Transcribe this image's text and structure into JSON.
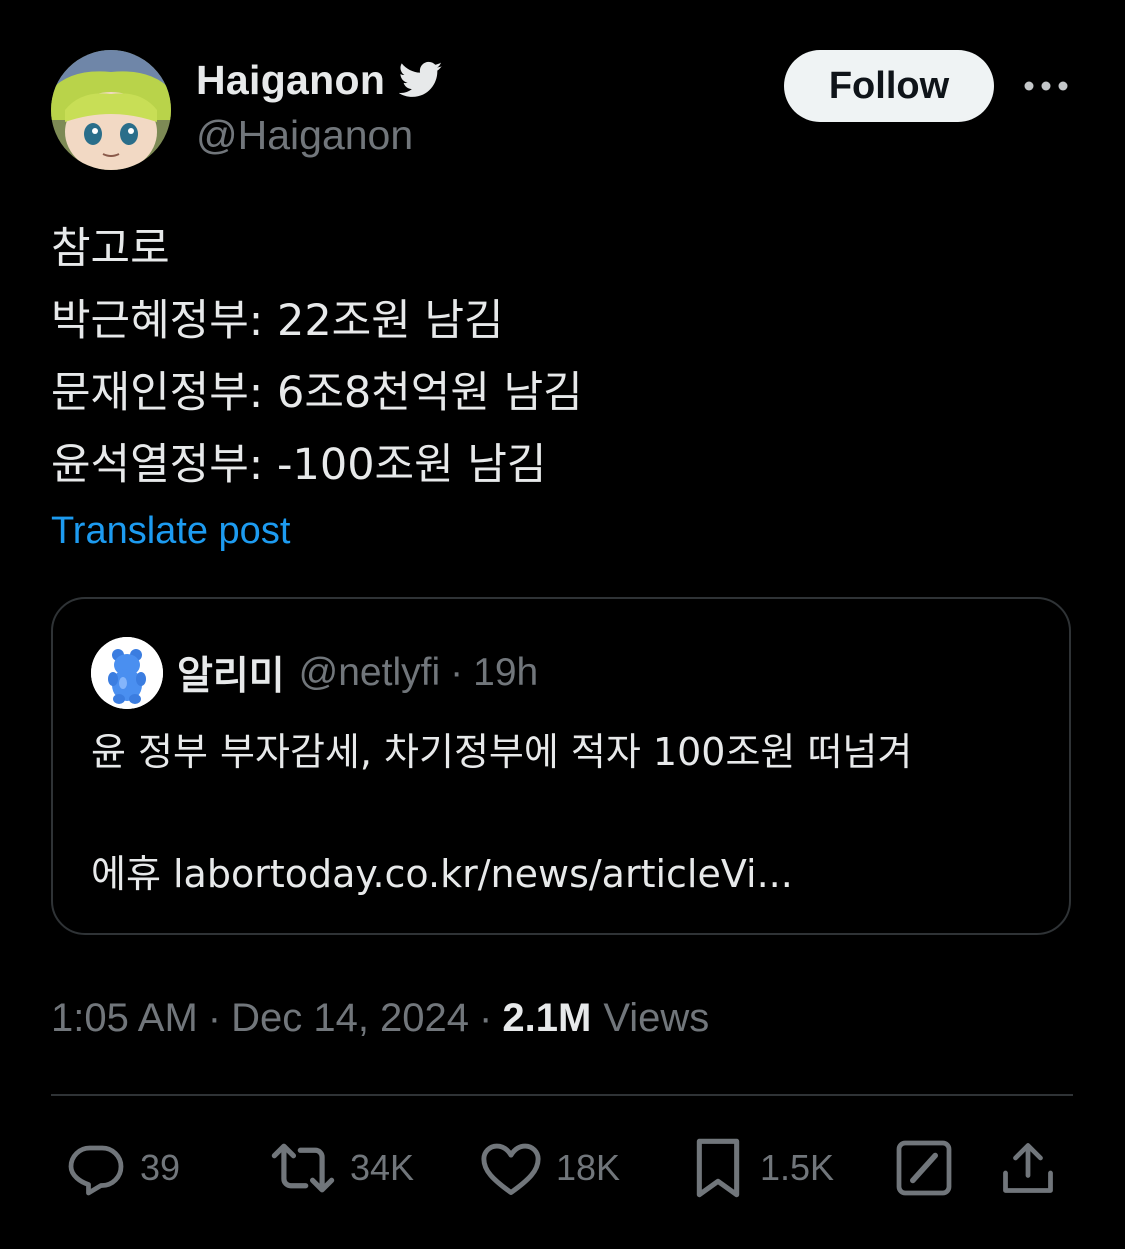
{
  "author": {
    "name": "Haiganon",
    "handle": "@Haiganon",
    "verified_icon": "twitter-bird-icon"
  },
  "follow_label": "Follow",
  "more_icon": "more-dots-icon",
  "post": {
    "lines": [
      "참고로",
      "박근혜정부: 22조원 남김",
      "문재인정부: 6조8천억원 남김",
      "윤석열정부: -100조원 남김"
    ]
  },
  "translate_label": "Translate post",
  "quote": {
    "name": "알리미",
    "handle": "@netlyfi",
    "separator": "·",
    "time": "19h",
    "line1": "윤 정부 부자감세, 차기정부에 적자 100조원 떠넘겨",
    "line2": "에휴 labortoday.co.kr/news/articleVi..."
  },
  "meta": {
    "time": "1:05 AM",
    "separator": "·",
    "date": "Dec 14, 2024",
    "views_count": "2.1M",
    "views_label": "Views"
  },
  "actions": {
    "replies": "39",
    "reposts": "34K",
    "likes": "18K",
    "bookmarks": "1.5K"
  },
  "colors": {
    "background": "#000000",
    "text": "#e7e9ea",
    "secondary": "#71767b",
    "link": "#1d9bf0",
    "border": "#2f3336"
  }
}
